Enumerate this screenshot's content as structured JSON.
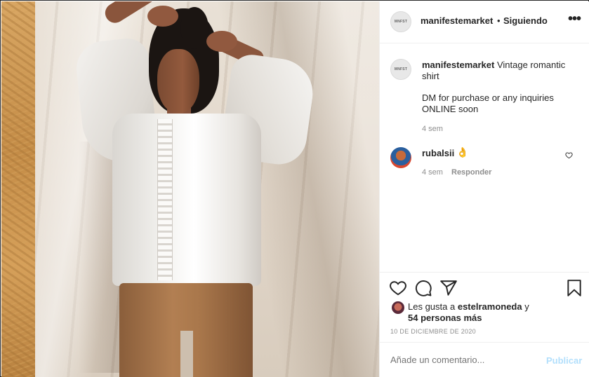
{
  "post": {
    "author": {
      "username": "manifestemarket",
      "avatar_text": "MNFST",
      "follow_status": "Siguiendo",
      "separator": "•"
    },
    "more_icon": "more-horizontal-icon",
    "caption": {
      "username": "manifestemarket",
      "text_line1": "Vintage romantic shirt",
      "text_line2": "DM for purchase or any inquiries ONLINE soon",
      "time": "4 sem"
    },
    "comments": [
      {
        "username": "rubalsii",
        "emoji": "👌",
        "time": "4 sem",
        "reply_label": "Responder",
        "like_icon": "heart-outline-icon"
      }
    ],
    "actions": {
      "like_icon": "heart-outline-icon",
      "comment_icon": "comment-icon",
      "share_icon": "paper-plane-icon",
      "save_icon": "bookmark-icon"
    },
    "likes": {
      "prefix": "Les gusta a",
      "first_user": "estelramoneda",
      "connector": "y",
      "others": "54 personas más"
    },
    "date": "10 DE DICIEMBRE DE 2020",
    "add_comment": {
      "placeholder": "Añade un comentario...",
      "publish_label": "Publicar"
    }
  },
  "colors": {
    "text": "#262626",
    "muted": "#8e8e8e",
    "divider": "#efefef",
    "publish_disabled": "#b2dffc"
  }
}
